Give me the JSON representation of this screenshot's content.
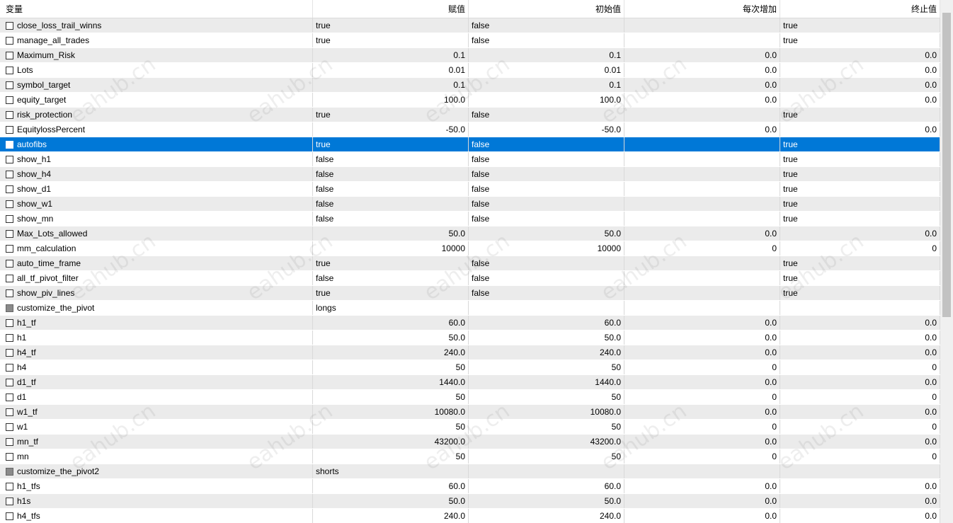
{
  "columns": [
    "变量",
    "赋值",
    "初始值",
    "每次增加",
    "终止值"
  ],
  "numeric_columns": [
    false,
    true,
    true,
    true,
    true
  ],
  "selected_row": 8,
  "watermark": "eahub.cn",
  "rows": [
    {
      "name": "close_loss_trail_winns",
      "checked": "off",
      "values": [
        "true",
        "false",
        "",
        "true"
      ],
      "numeric": false
    },
    {
      "name": "manage_all_trades",
      "checked": "off",
      "values": [
        "true",
        "false",
        "",
        "true"
      ],
      "numeric": false
    },
    {
      "name": "Maximum_Risk",
      "checked": "off",
      "values": [
        "0.1",
        "0.1",
        "0.0",
        "0.0"
      ],
      "numeric": true
    },
    {
      "name": "Lots",
      "checked": "off",
      "values": [
        "0.01",
        "0.01",
        "0.0",
        "0.0"
      ],
      "numeric": true
    },
    {
      "name": "symbol_target",
      "checked": "off",
      "values": [
        "0.1",
        "0.1",
        "0.0",
        "0.0"
      ],
      "numeric": true
    },
    {
      "name": "equity_target",
      "checked": "off",
      "values": [
        "100.0",
        "100.0",
        "0.0",
        "0.0"
      ],
      "numeric": true
    },
    {
      "name": "risk_protection",
      "checked": "off",
      "values": [
        "true",
        "false",
        "",
        "true"
      ],
      "numeric": false
    },
    {
      "name": "EquitylossPercent",
      "checked": "off",
      "values": [
        "-50.0",
        "-50.0",
        "0.0",
        "0.0"
      ],
      "numeric": true
    },
    {
      "name": "autofibs",
      "checked": "off",
      "values": [
        "true",
        "false",
        "",
        "true"
      ],
      "numeric": false
    },
    {
      "name": "show_h1",
      "checked": "off",
      "values": [
        "false",
        "false",
        "",
        "true"
      ],
      "numeric": false
    },
    {
      "name": "show_h4",
      "checked": "off",
      "values": [
        "false",
        "false",
        "",
        "true"
      ],
      "numeric": false
    },
    {
      "name": "show_d1",
      "checked": "off",
      "values": [
        "false",
        "false",
        "",
        "true"
      ],
      "numeric": false
    },
    {
      "name": "show_w1",
      "checked": "off",
      "values": [
        "false",
        "false",
        "",
        "true"
      ],
      "numeric": false
    },
    {
      "name": "show_mn",
      "checked": "off",
      "values": [
        "false",
        "false",
        "",
        "true"
      ],
      "numeric": false
    },
    {
      "name": "Max_Lots_allowed",
      "checked": "off",
      "values": [
        "50.0",
        "50.0",
        "0.0",
        "0.0"
      ],
      "numeric": true
    },
    {
      "name": "mm_calculation",
      "checked": "off",
      "values": [
        "10000",
        "10000",
        "0",
        "0"
      ],
      "numeric": true
    },
    {
      "name": "auto_time_frame",
      "checked": "off",
      "values": [
        "true",
        "false",
        "",
        "true"
      ],
      "numeric": false
    },
    {
      "name": "all_tf_pivot_filter",
      "checked": "off",
      "values": [
        "false",
        "false",
        "",
        "true"
      ],
      "numeric": false
    },
    {
      "name": "show_piv_lines",
      "checked": "off",
      "values": [
        "true",
        "false",
        "",
        "true"
      ],
      "numeric": false
    },
    {
      "name": "customize_the_pivot",
      "checked": "ind",
      "values": [
        "longs",
        "",
        "",
        ""
      ],
      "numeric": false
    },
    {
      "name": "h1_tf",
      "checked": "off",
      "values": [
        "60.0",
        "60.0",
        "0.0",
        "0.0"
      ],
      "numeric": true
    },
    {
      "name": "h1",
      "checked": "off",
      "values": [
        "50.0",
        "50.0",
        "0.0",
        "0.0"
      ],
      "numeric": true
    },
    {
      "name": "h4_tf",
      "checked": "off",
      "values": [
        "240.0",
        "240.0",
        "0.0",
        "0.0"
      ],
      "numeric": true
    },
    {
      "name": "h4",
      "checked": "off",
      "values": [
        "50",
        "50",
        "0",
        "0"
      ],
      "numeric": true
    },
    {
      "name": "d1_tf",
      "checked": "off",
      "values": [
        "1440.0",
        "1440.0",
        "0.0",
        "0.0"
      ],
      "numeric": true
    },
    {
      "name": "d1",
      "checked": "off",
      "values": [
        "50",
        "50",
        "0",
        "0"
      ],
      "numeric": true
    },
    {
      "name": "w1_tf",
      "checked": "off",
      "values": [
        "10080.0",
        "10080.0",
        "0.0",
        "0.0"
      ],
      "numeric": true
    },
    {
      "name": "w1",
      "checked": "off",
      "values": [
        "50",
        "50",
        "0",
        "0"
      ],
      "numeric": true
    },
    {
      "name": "mn_tf",
      "checked": "off",
      "values": [
        "43200.0",
        "43200.0",
        "0.0",
        "0.0"
      ],
      "numeric": true
    },
    {
      "name": "mn",
      "checked": "off",
      "values": [
        "50",
        "50",
        "0",
        "0"
      ],
      "numeric": true
    },
    {
      "name": "customize_the_pivot2",
      "checked": "ind",
      "values": [
        "shorts",
        "",
        "",
        ""
      ],
      "numeric": false
    },
    {
      "name": "h1_tfs",
      "checked": "off",
      "values": [
        "60.0",
        "60.0",
        "0.0",
        "0.0"
      ],
      "numeric": true
    },
    {
      "name": "h1s",
      "checked": "off",
      "values": [
        "50.0",
        "50.0",
        "0.0",
        "0.0"
      ],
      "numeric": true
    },
    {
      "name": "h4_tfs",
      "checked": "off",
      "values": [
        "240.0",
        "240.0",
        "0.0",
        "0.0"
      ],
      "numeric": true
    }
  ]
}
